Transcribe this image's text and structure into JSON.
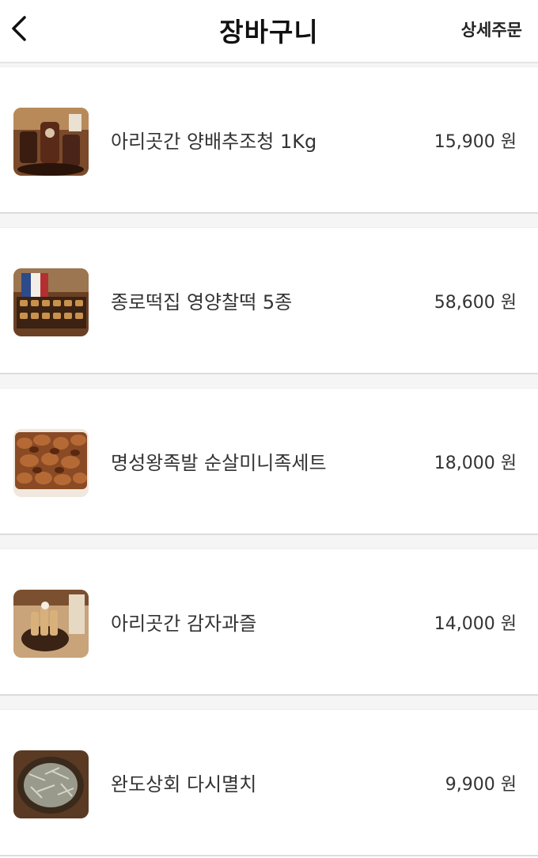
{
  "header": {
    "title": "장바구니",
    "detail_label": "상세주문"
  },
  "items": [
    {
      "name": "아리곳간 양배추조청 1Kg",
      "price": "15,900 원"
    },
    {
      "name": "종로떡집 영양찰떡 5종",
      "price": "58,600 원"
    },
    {
      "name": "명성왕족발 순살미니족세트",
      "price": "18,000 원"
    },
    {
      "name": "아리곳간 감자과즐",
      "price": "14,000 원"
    },
    {
      "name": "완도상회 다시멸치",
      "price": "9,900 원"
    }
  ]
}
